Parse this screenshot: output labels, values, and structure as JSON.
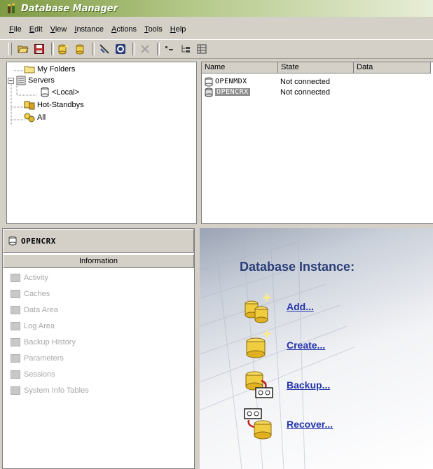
{
  "window": {
    "title": "Database Manager"
  },
  "menu": [
    "File",
    "Edit",
    "View",
    "Instance",
    "Actions",
    "Tools",
    "Help"
  ],
  "toolbar": {
    "icons": [
      "open-icon",
      "save-icon",
      "db-add-icon",
      "db-icon",
      "disconnect-icon",
      "refresh-icon",
      "delete-icon",
      "list-view-icon",
      "tree-view-icon",
      "detail-view-icon"
    ]
  },
  "tree": {
    "my_folders": "My Folders",
    "servers": "Servers",
    "local": "<Local>",
    "hot_standbys": "Hot-Standbys",
    "all": "All"
  },
  "list": {
    "columns": [
      "Name",
      "State",
      "Data"
    ],
    "rows": [
      {
        "name": "OPENMDX",
        "state": "Not connected"
      },
      {
        "name": "OPENCRX",
        "state": "Not connected",
        "selected": true
      }
    ]
  },
  "info": {
    "title": "OPENCRX",
    "tab": "Information",
    "items": [
      "Activity",
      "Caches",
      "Data Area",
      "Log Area",
      "Backup History",
      "Parameters",
      "Sessions",
      "System Info Tables"
    ]
  },
  "instance": {
    "title": "Database Instance:",
    "actions": [
      "Add...",
      "Create...",
      "Backup...",
      "Recover..."
    ]
  },
  "colors": {
    "title_gradient_start": "#7e9a43",
    "link": "#2233aa",
    "heading": "#2a3e78"
  }
}
